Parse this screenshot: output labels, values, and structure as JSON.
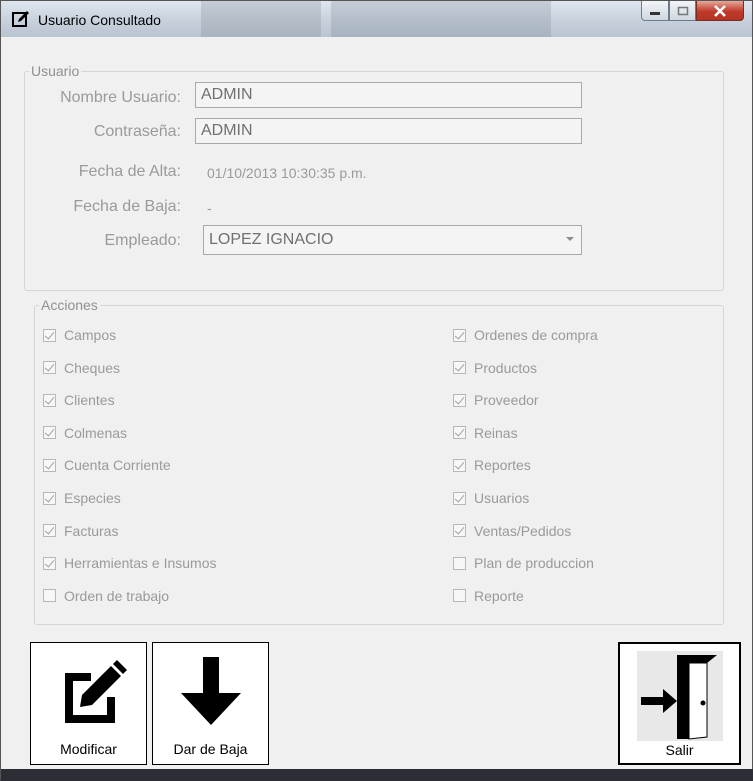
{
  "window": {
    "title": "Usuario Consultado"
  },
  "usuario": {
    "legend": "Usuario",
    "nombre_label": "Nombre Usuario:",
    "nombre_value": "ADMIN",
    "password_label": "Contraseña:",
    "password_value": "ADMIN",
    "fecha_alta_label": "Fecha de Alta:",
    "fecha_alta_value": "01/10/2013 10:30:35 p.m.",
    "fecha_baja_label": "Fecha de Baja:",
    "fecha_baja_value": "-",
    "empleado_label": "Empleado:",
    "empleado_value": "LOPEZ IGNACIO"
  },
  "acciones": {
    "legend": "Acciones",
    "left": [
      {
        "label": "Campos",
        "checked": true
      },
      {
        "label": "Cheques",
        "checked": true
      },
      {
        "label": "Clientes",
        "checked": true
      },
      {
        "label": "Colmenas",
        "checked": true
      },
      {
        "label": "Cuenta Corriente",
        "checked": true
      },
      {
        "label": "Especies",
        "checked": true
      },
      {
        "label": "Facturas",
        "checked": true
      },
      {
        "label": "Herramientas e Insumos",
        "checked": true
      },
      {
        "label": "Orden de trabajo",
        "checked": false
      }
    ],
    "right": [
      {
        "label": "Ordenes de compra",
        "checked": true
      },
      {
        "label": "Productos",
        "checked": true
      },
      {
        "label": "Proveedor",
        "checked": true
      },
      {
        "label": "Reinas",
        "checked": true
      },
      {
        "label": "Reportes",
        "checked": true
      },
      {
        "label": "Usuarios",
        "checked": true
      },
      {
        "label": "Ventas/Pedidos",
        "checked": true
      },
      {
        "label": "Plan de produccion",
        "checked": false
      },
      {
        "label": "Reporte",
        "checked": false
      }
    ]
  },
  "buttons": {
    "modificar": "Modificar",
    "dar_de_baja": "Dar de Baja",
    "salir": "Salir"
  },
  "icons": {
    "title": "edit-icon",
    "modificar": "edit-icon",
    "dar_de_baja": "arrow-down-icon",
    "salir": "exit-door-icon"
  }
}
